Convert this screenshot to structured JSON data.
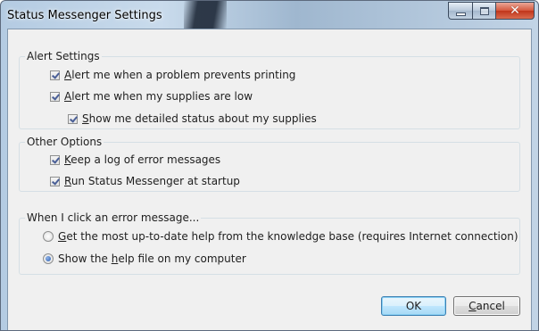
{
  "window": {
    "title": "Status Messenger Settings"
  },
  "caption": {
    "minimize_icon": "minimize-icon",
    "maximize_icon": "maximize-icon",
    "close_glyph": "✕"
  },
  "alert_settings": {
    "legend": "Alert Settings",
    "options": [
      {
        "pre": "",
        "hot": "A",
        "post": "lert me when a problem prevents printing",
        "checked": true
      },
      {
        "pre": "",
        "hot": "A",
        "post": "lert me when my supplies are low",
        "checked": true
      },
      {
        "pre": "",
        "hot": "S",
        "post": "how me detailed status about my supplies",
        "checked": true
      }
    ]
  },
  "other_options": {
    "legend": "Other Options",
    "options": [
      {
        "pre": "",
        "hot": "K",
        "post": "eep a log of error messages",
        "checked": true
      },
      {
        "pre": "",
        "hot": "R",
        "post": "un Status Messenger at startup",
        "checked": true
      }
    ]
  },
  "error_click": {
    "legend": "When I click an error message...",
    "options": [
      {
        "pre": "",
        "hot": "G",
        "post": "et the most up-to-date help from the knowledge base (requires Internet connection)",
        "selected": false
      },
      {
        "pre": "Show the ",
        "hot": "h",
        "post": "elp file on my computer",
        "selected": true
      }
    ]
  },
  "buttons": {
    "ok": {
      "pre": "OK",
      "hot": "",
      "post": ""
    },
    "cancel": {
      "pre": "",
      "hot": "C",
      "post": "ancel"
    }
  }
}
